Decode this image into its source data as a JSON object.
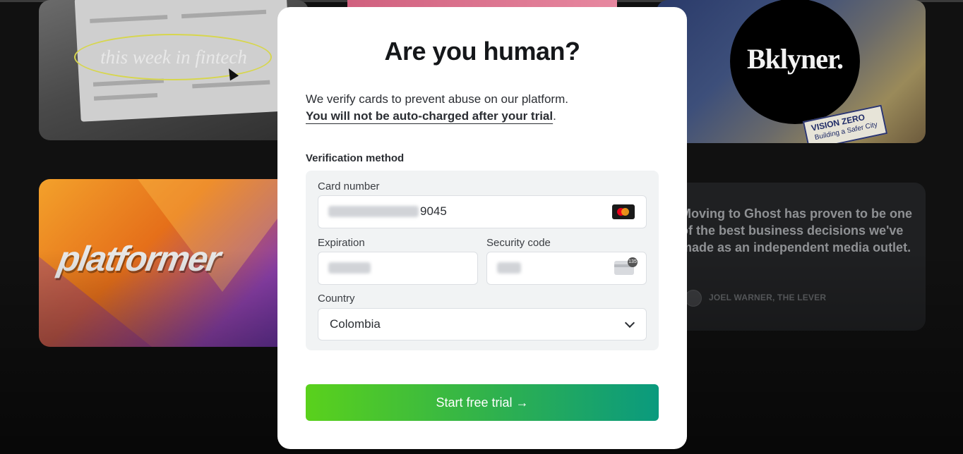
{
  "background": {
    "news_card": {
      "title": "this week in fintech"
    },
    "bklyner_card": {
      "logo": "Bklyner.",
      "sign_title": "VISION ZERO",
      "sign_subtitle": "Building a Safer City"
    },
    "platformer_card": {
      "logo": "platformer"
    },
    "quote_card": {
      "quote": "Moving to Ghost has proven to be one of the best business decisions we've made as an independent media outlet.",
      "author": "JOEL WARNER, THE LEVER"
    }
  },
  "modal": {
    "title": "Are you human?",
    "lead_line1": "We verify cards to prevent abuse on our platform.",
    "lead_line2_strong": "You will not be auto-charged after your trial",
    "lead_line2_end": ".",
    "section_label": "Verification method",
    "card_number": {
      "label": "Card number",
      "last4": "9045",
      "brand_icon": "mastercard-icon"
    },
    "expiration": {
      "label": "Expiration"
    },
    "security_code": {
      "label": "Security code",
      "icon": "cvc-icon",
      "icon_badge": "135"
    },
    "country": {
      "label": "Country",
      "value": "Colombia"
    },
    "cta": {
      "label": "Start free trial →"
    }
  },
  "colors": {
    "cta_start": "#5ad11c",
    "cta_end": "#0a9a7e",
    "page_background": "#111111",
    "panel_background": "#f1f3f4"
  }
}
